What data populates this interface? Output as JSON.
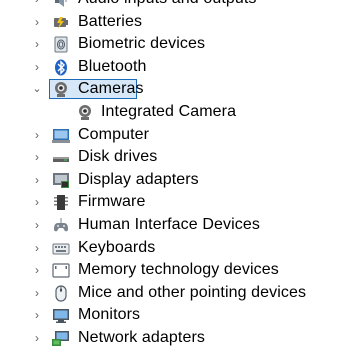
{
  "device_tree": {
    "items": [
      {
        "label": "Audio inputs and outputs",
        "icon": "speaker-icon",
        "state": "collapsed"
      },
      {
        "label": "Batteries",
        "icon": "battery-icon",
        "state": "collapsed"
      },
      {
        "label": "Biometric devices",
        "icon": "fingerprint-icon",
        "state": "collapsed"
      },
      {
        "label": "Bluetooth",
        "icon": "bluetooth-icon",
        "state": "collapsed"
      },
      {
        "label": "Cameras",
        "icon": "webcam-icon",
        "state": "expanded",
        "selected": true
      },
      {
        "label": "Integrated Camera",
        "icon": "webcam-icon",
        "child": true
      },
      {
        "label": "Computer",
        "icon": "computer-icon",
        "state": "collapsed"
      },
      {
        "label": "Disk drives",
        "icon": "disk-drive-icon",
        "state": "collapsed"
      },
      {
        "label": "Display adapters",
        "icon": "display-adapter-icon",
        "state": "collapsed"
      },
      {
        "label": "Firmware",
        "icon": "firmware-icon",
        "state": "collapsed"
      },
      {
        "label": "Human Interface Devices",
        "icon": "hid-icon",
        "state": "collapsed"
      },
      {
        "label": "Keyboards",
        "icon": "keyboard-icon",
        "state": "collapsed"
      },
      {
        "label": "Memory technology devices",
        "icon": "memory-card-icon",
        "state": "collapsed"
      },
      {
        "label": "Mice and other pointing devices",
        "icon": "mouse-icon",
        "state": "collapsed"
      },
      {
        "label": "Monitors",
        "icon": "monitor-icon",
        "state": "collapsed"
      },
      {
        "label": "Network adapters",
        "icon": "network-adapter-icon",
        "state": "collapsed"
      }
    ]
  },
  "colors": {
    "selection_border": "#1c6bb8",
    "selection_fill": "#d6e8f7",
    "chevron": "#606060"
  }
}
